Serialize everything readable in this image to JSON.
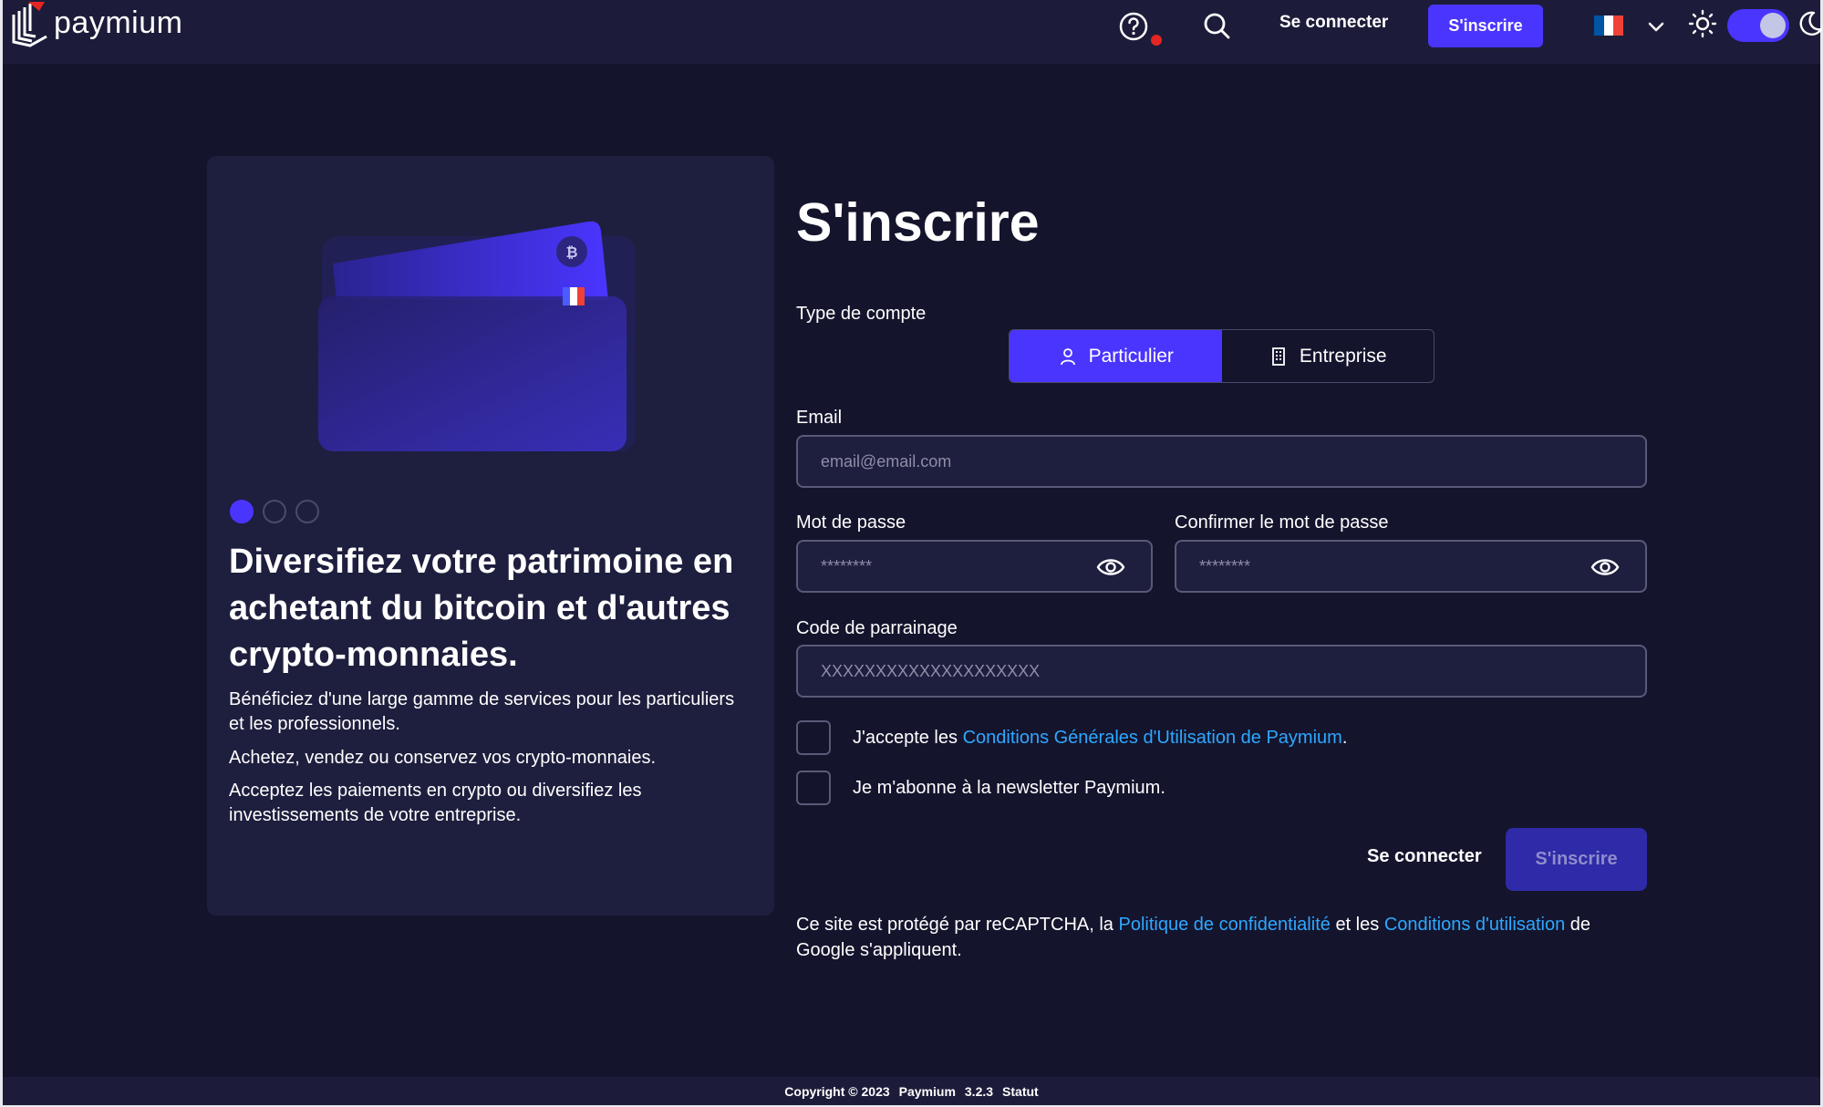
{
  "header": {
    "brand": "paymium",
    "nav_login": "Se connecter",
    "nav_signup": "S'inscrire",
    "language": "fr",
    "flag_colors": [
      "#0055a4",
      "#ffffff",
      "#ef4135"
    ],
    "accent": "#4a35ff",
    "icons": [
      "help-icon",
      "search-icon",
      "chevron-down-icon",
      "sun-icon",
      "moon-icon"
    ]
  },
  "promo": {
    "slides": 3,
    "active_slide": 1,
    "title": "Diversifiez votre patrimoine en achetant du bitcoin et d'autres crypto-monnaies.",
    "p1": "Bénéficiez d'une large gamme de services pour les particuliers et les professionnels.",
    "p2": "Achetez, vendez ou conservez vos crypto-monnaies.",
    "p3": "Acceptez les paiements en crypto ou diversifiez les investissements de votre entreprise."
  },
  "form": {
    "title": "S'inscrire",
    "account_type_label": "Type de compte",
    "account_types": [
      {
        "label": "Particulier",
        "selected": true
      },
      {
        "label": "Entreprise",
        "selected": false
      }
    ],
    "email_label": "Email",
    "email_placeholder": "email@email.com",
    "password_label": "Mot de passe",
    "password_placeholder": "********",
    "confirm_label": "Confirmer le mot de passe",
    "confirm_placeholder": "********",
    "referral_label": "Code de parrainage",
    "referral_placeholder": "XXXXXXXXXXXXXXXXXXXX",
    "cgu_prefix": "J'accepte les",
    "cgu_link": "Conditions Générales d'Utilisation de Paymium",
    "cgu_suffix": ".",
    "newsletter": "Je m'abonne à la newsletter Paymium.",
    "login": "Se connecter",
    "submit": "S'inscrire",
    "recaptcha_1": "Ce site est protégé par reCAPTCHA, la",
    "recaptcha_link1": "Politique de confidentialité",
    "recaptcha_2": "et les",
    "recaptcha_link2": "Conditions d'utilisation",
    "recaptcha_3": "de Google s'appliquent."
  },
  "footer": {
    "copyright": "Copyright © 2023",
    "brand": "Paymium",
    "version": "3.2.3",
    "status": "Statut"
  }
}
